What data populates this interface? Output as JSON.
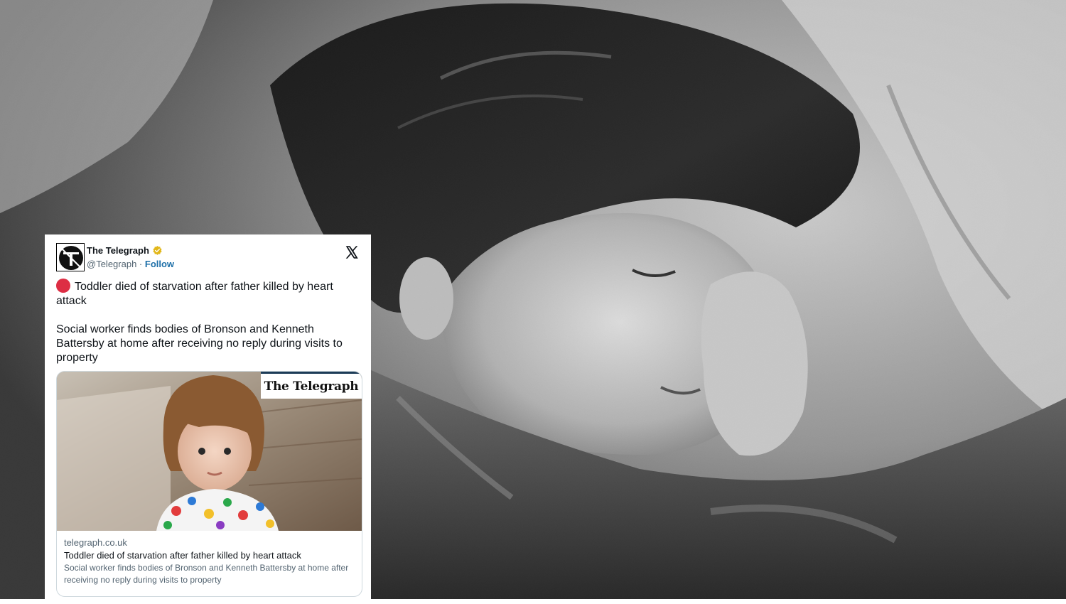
{
  "background": {
    "icons": [
      "sleeping-child-photo"
    ]
  },
  "tweet": {
    "author_name": "The Telegraph",
    "author_handle": "@Telegraph",
    "separator": "·",
    "follow_label": "Follow",
    "verified_badge_color": "#e2b719",
    "alert_icon_color": "#dd2e44",
    "headline": "Toddler died of starvation after father killed by heart attack",
    "body": "Social worker finds bodies of Bronson and Kenneth Battersby at home after receiving no reply during visits to property",
    "link_card": {
      "brand": "The Telegraph",
      "domain": "telegraph.co.uk",
      "title": "Toddler died of starvation after father killed by heart attack",
      "description": "Social worker finds bodies of Bronson and Kenneth Battersby at home after receiving no reply during visits to property"
    },
    "colors": {
      "link": "#1d6fa8",
      "text": "#0f1419",
      "muted": "#536471"
    }
  }
}
